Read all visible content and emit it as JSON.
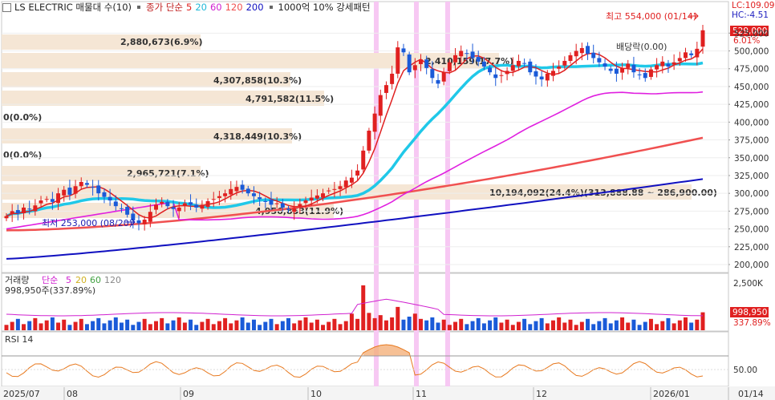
{
  "header": {
    "title": "LS ELECTRIC 매물대 수(10)",
    "legend_price": "종가 단순",
    "ma_periods": [
      "5",
      "20",
      "60",
      "120",
      "200"
    ],
    "ma_colors": [
      "#e02020",
      "#20c8e8",
      "#e020e0",
      "#f05050",
      "#1010c0"
    ],
    "volume_legend": "1000억 10% 강세패턴",
    "lc_label": "LC:109.09",
    "hc_label": "HC:-4.51"
  },
  "price_panel": {
    "current_price_label": "529,000",
    "current_change_label": "6.01%",
    "high_annotation": "최고 554,000 (01/14)",
    "low_annotation": "최저 253,000 (08/20)",
    "dividend_label": "배당락(0.00)",
    "y_ticks": [
      "525,000",
      "500,000",
      "475,000",
      "450,000",
      "425,000",
      "400,000",
      "375,000",
      "350,000",
      "325,000",
      "300,000",
      "275,000",
      "250,000",
      "225,000",
      "200,000"
    ],
    "volume_profile": [
      {
        "label": "2,880,673(6.9%)"
      },
      {
        "label": "2,410,159(17.7%)"
      },
      {
        "label": "4,307,858(10.3%)"
      },
      {
        "label": "4,791,582(11.5%)"
      },
      {
        "label": "0(0.0%)"
      },
      {
        "label": "4,318,449(10.3%)"
      },
      {
        "label": "0(0.0%)"
      },
      {
        "label": "2,965,721(7.1%)"
      },
      {
        "label": "10,194,092(24.4%)(313,888.88 ~ 286,900.00)"
      },
      {
        "label": "4,956,853(11.9%)"
      }
    ]
  },
  "volume_panel": {
    "legend_title": "거래량",
    "legend_ma": "단순",
    "ma_periods": [
      "5",
      "20",
      "60",
      "120"
    ],
    "ma_colors": [
      "#e020e0",
      "#e0c020",
      "#40a040",
      "#888888"
    ],
    "current_label": "998,950주(337.89%)",
    "y_tick_top": "2,500K",
    "current_value_label": "998,950",
    "current_pct_label": "337.89%"
  },
  "rsi_panel": {
    "legend": "RSI 14",
    "y_tick": "50.00"
  },
  "x_axis": {
    "labels": [
      "2025/07",
      "08",
      "09",
      "10",
      "11",
      "12",
      "2026/01"
    ],
    "right_label": "01/14"
  },
  "chart_data": {
    "type": "candlestick",
    "title": "LS ELECTRIC",
    "x_start": "2025/07",
    "x_end": "2026/01/14",
    "high": 554000,
    "low": 253000,
    "last_close": 529000,
    "ylim": [
      195000,
      560000
    ],
    "moving_averages": [
      {
        "name": "5",
        "color": "#e02020"
      },
      {
        "name": "20",
        "color": "#20c8e8"
      },
      {
        "name": "60",
        "color": "#e020e0"
      },
      {
        "name": "120",
        "color": "#f05050"
      },
      {
        "name": "200",
        "color": "#1010c0"
      }
    ],
    "close_series": [
      268000,
      275000,
      272000,
      280000,
      278000,
      283000,
      290000,
      292000,
      288000,
      300000,
      305000,
      298000,
      310000,
      316000,
      312000,
      308000,
      300000,
      295000,
      290000,
      282000,
      278000,
      270000,
      262000,
      258000,
      263000,
      274000,
      284000,
      288000,
      282000,
      278000,
      280000,
      286000,
      284000,
      280000,
      284000,
      289000,
      292000,
      296000,
      300000,
      306000,
      309000,
      305000,
      300000,
      296000,
      292000,
      288000,
      284000,
      286000,
      280000,
      277000,
      279000,
      285000,
      290000,
      294000,
      297000,
      300000,
      304000,
      306000,
      310000,
      318000,
      322000,
      332000,
      360000,
      388000,
      412000,
      438000,
      452000,
      468000,
      505000,
      498000,
      470000,
      480000,
      488000,
      476000,
      462000,
      454000,
      470000,
      484000,
      494000,
      500000,
      496000,
      490000,
      485000,
      478000,
      470000,
      462000,
      466000,
      472000,
      480000,
      486000,
      482000,
      470000,
      464000,
      460000,
      468000,
      472000,
      478000,
      486000,
      494000,
      500000,
      504000,
      496000,
      490000,
      484000,
      478000,
      472000,
      468000,
      476000,
      482000,
      470000,
      466000,
      462000,
      474000,
      480000,
      485000,
      478000,
      484000,
      490000,
      498000,
      494000,
      503000,
      529000
    ]
  }
}
